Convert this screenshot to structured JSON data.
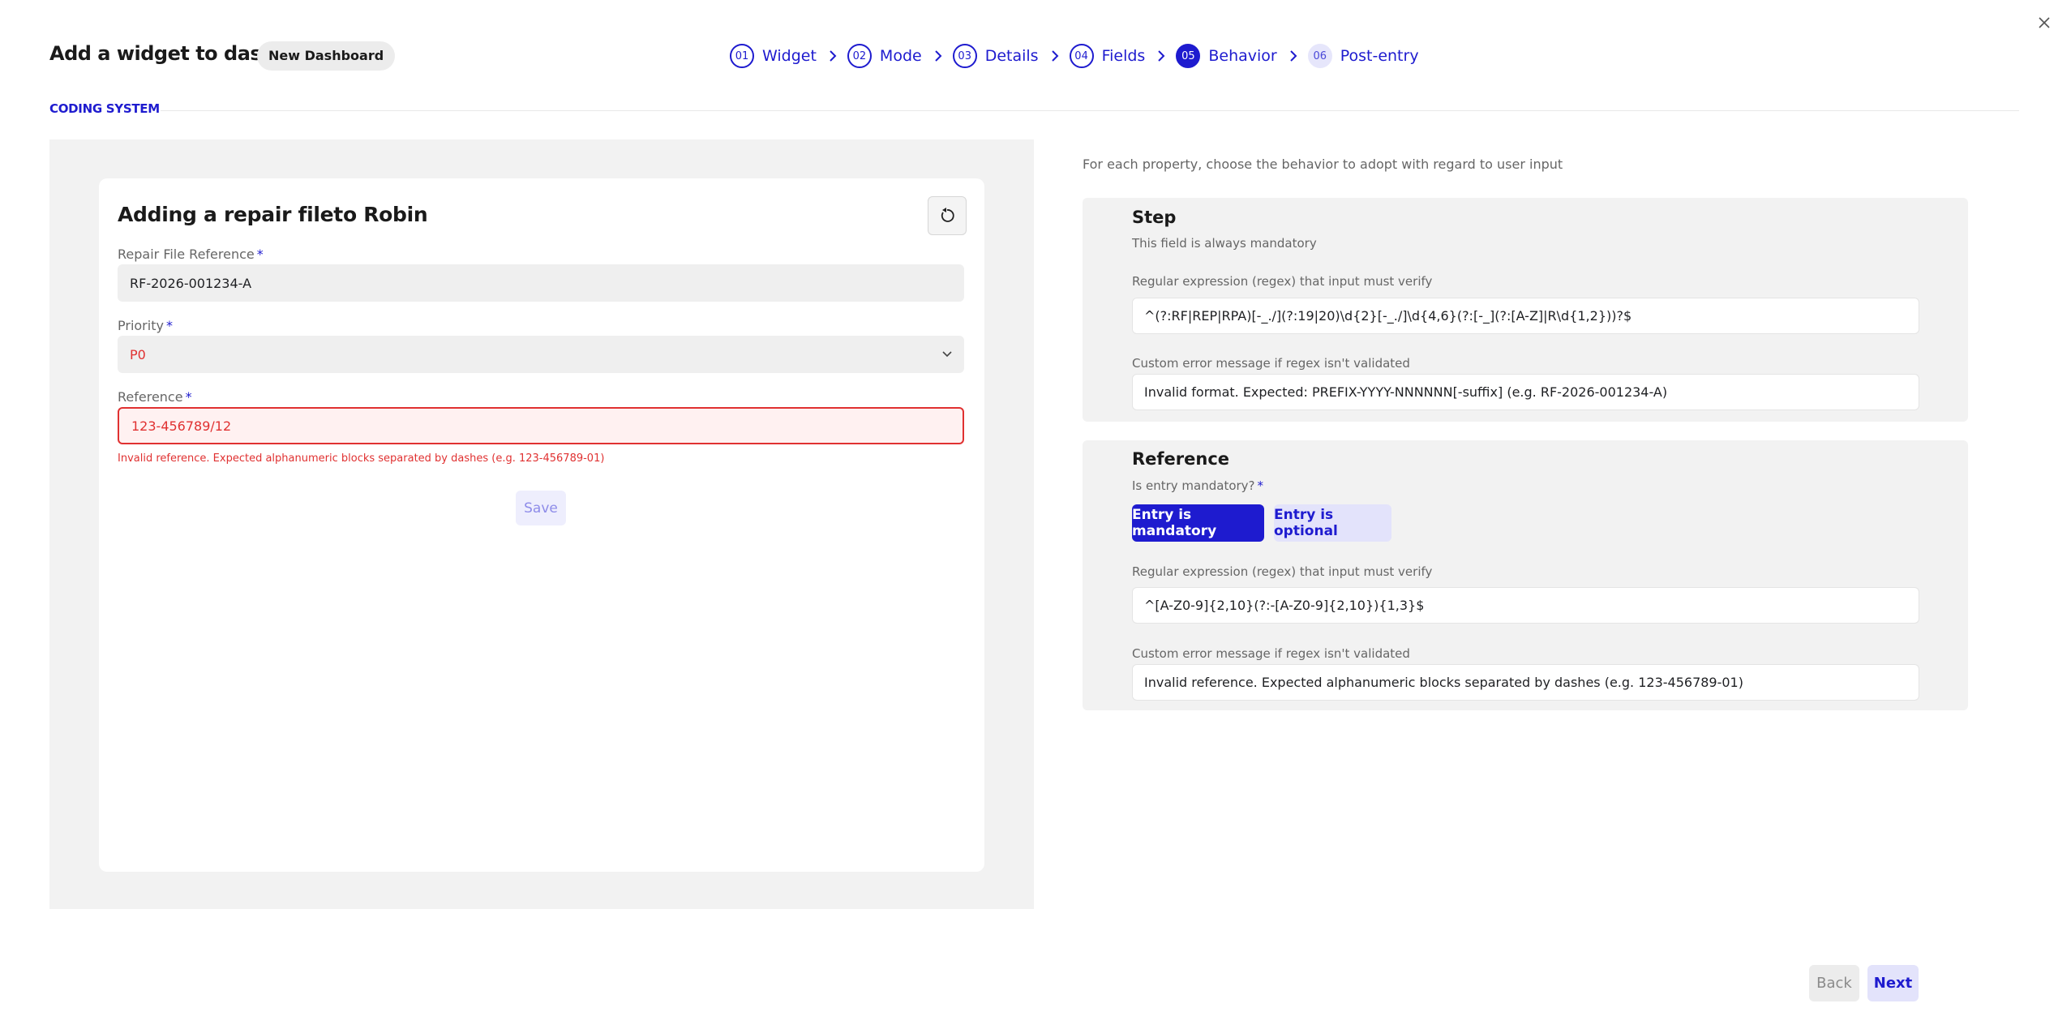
{
  "header": {
    "title": "Add a widget to dashboard",
    "dashboard_badge": "New Dashboard"
  },
  "stepper": [
    {
      "num": "01",
      "label": "Widget",
      "state": "done"
    },
    {
      "num": "02",
      "label": "Mode",
      "state": "done"
    },
    {
      "num": "03",
      "label": "Details",
      "state": "done"
    },
    {
      "num": "04",
      "label": "Fields",
      "state": "done"
    },
    {
      "num": "05",
      "label": "Behavior",
      "state": "active"
    },
    {
      "num": "06",
      "label": "Post-entry",
      "state": "upcoming"
    }
  ],
  "section_label": "CODING SYSTEM",
  "preview": {
    "title": "Adding a repair fileto Robin",
    "fields": {
      "repair_ref": {
        "label": "Repair File Reference",
        "value": "RF-2026-001234-A"
      },
      "priority": {
        "label": "Priority",
        "value": "P0"
      },
      "reference": {
        "label": "Reference",
        "value": "123-456789/12",
        "error": "Invalid reference. Expected alphanumeric blocks separated by dashes (e.g. 123-456789-01)"
      }
    },
    "save_label": "Save"
  },
  "config": {
    "intro": "For each property, choose the behavior to adopt with regard to user input",
    "step": {
      "title": "Step",
      "note": "This field is always mandatory",
      "regex_label": "Regular expression (regex) that input must verify",
      "regex_value": "^(?:RF|REP|RPA)[-_./](?:19|20)\\d{2}[-_./]\\d{4,6}(?:[-_](?:[A-Z]|R\\d{1,2}))?$",
      "error_label": "Custom error message if regex isn't validated",
      "error_value": "Invalid format. Expected: PREFIX-YYYY-NNNNNN[-suffix] (e.g. RF-2026-001234-A)"
    },
    "reference": {
      "title": "Reference",
      "mandatory_question": "Is entry mandatory?",
      "mandatory_label": "Entry is mandatory",
      "optional_label": "Entry is optional",
      "regex_label": "Regular expression (regex) that input must verify",
      "regex_value": "^[A-Z0-9]{2,10}(?:-[A-Z0-9]{2,10}){1,3}$",
      "error_label": "Custom error message if regex isn't validated",
      "error_value": "Invalid reference. Expected alphanumeric blocks separated by dashes (e.g. 123-456789-01)"
    }
  },
  "footer": {
    "back_label": "Back",
    "next_label": "Next"
  },
  "colors": {
    "accent": "#1e1bcf",
    "error": "#e03131",
    "panel": "#f2f2f2"
  }
}
